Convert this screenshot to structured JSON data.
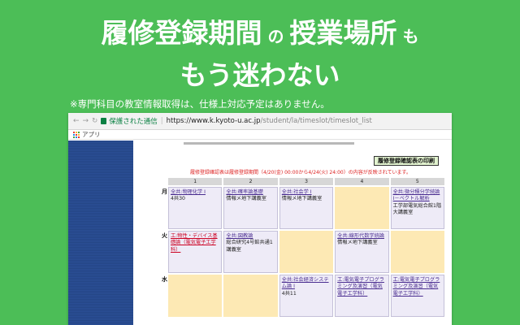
{
  "headline": {
    "line1": [
      {
        "text": "履修登録期間",
        "size": "big"
      },
      {
        "text": " の ",
        "size": "small"
      },
      {
        "text": "授業場所",
        "size": "big"
      },
      {
        "text": " も",
        "size": "small"
      }
    ],
    "line2": "もう迷わない"
  },
  "note": "※専門科目の教室情報取得は、仕様上対応予定はありません。",
  "browser": {
    "secure_label": "保護された通信",
    "url_host": "https://www.k.kyoto-u.ac.jp",
    "url_path": "/student/la/timeslot/timeslot_list",
    "bookmark_apps": "アプリ"
  },
  "page": {
    "print_button": "履修登録確認表の印刷",
    "red_note": "履修登録確認表は履修登録期間（4/20(金) 00:00から4/24(火) 24:00）の内容が反映されています。"
  },
  "timetable": {
    "periods": [
      "1",
      "2",
      "3",
      "4",
      "5"
    ],
    "rows": [
      {
        "day": "月",
        "cells": [
          {
            "state": "filled",
            "link": "全共:物理化学 I",
            "room": "4共30"
          },
          {
            "state": "filled",
            "link": "全共:確率論基礎",
            "room": "情報メ地下講義室"
          },
          {
            "state": "filled",
            "link": "全共:社会学 I",
            "room": "情報メ地下講義室"
          },
          {
            "state": "empty",
            "link": "",
            "room": ""
          },
          {
            "state": "filled",
            "link": "全共:微分積分学続論 I－ベクトル解析",
            "room": "工学部電気総合館1階大講義室"
          }
        ]
      },
      {
        "day": "火",
        "cells": [
          {
            "state": "filled",
            "link": "工:物性・デバイス基礎論（電気電子工学科）",
            "room": "",
            "red": true
          },
          {
            "state": "filled",
            "link": "全共:図教論",
            "room": "総合研究4号館共通1講義室"
          },
          {
            "state": "empty",
            "link": "",
            "room": ""
          },
          {
            "state": "filled",
            "link": "全共:線形代数学続論",
            "room": "情報メ地下講義室"
          },
          {
            "state": "empty",
            "link": "",
            "room": ""
          }
        ]
      },
      {
        "day": "水",
        "cells": [
          {
            "state": "empty",
            "link": "",
            "room": ""
          },
          {
            "state": "empty",
            "link": "",
            "room": ""
          },
          {
            "state": "filled",
            "link": "全共:社会経済システム論 I",
            "room": "4共11"
          },
          {
            "state": "filled",
            "link": "工:電気電子プログラミング及演習（電気電子工学科）",
            "room": ""
          },
          {
            "state": "filled",
            "link": "工:電気電子プログラミング及演習（電気電子工学科）",
            "room": ""
          }
        ]
      }
    ]
  }
}
